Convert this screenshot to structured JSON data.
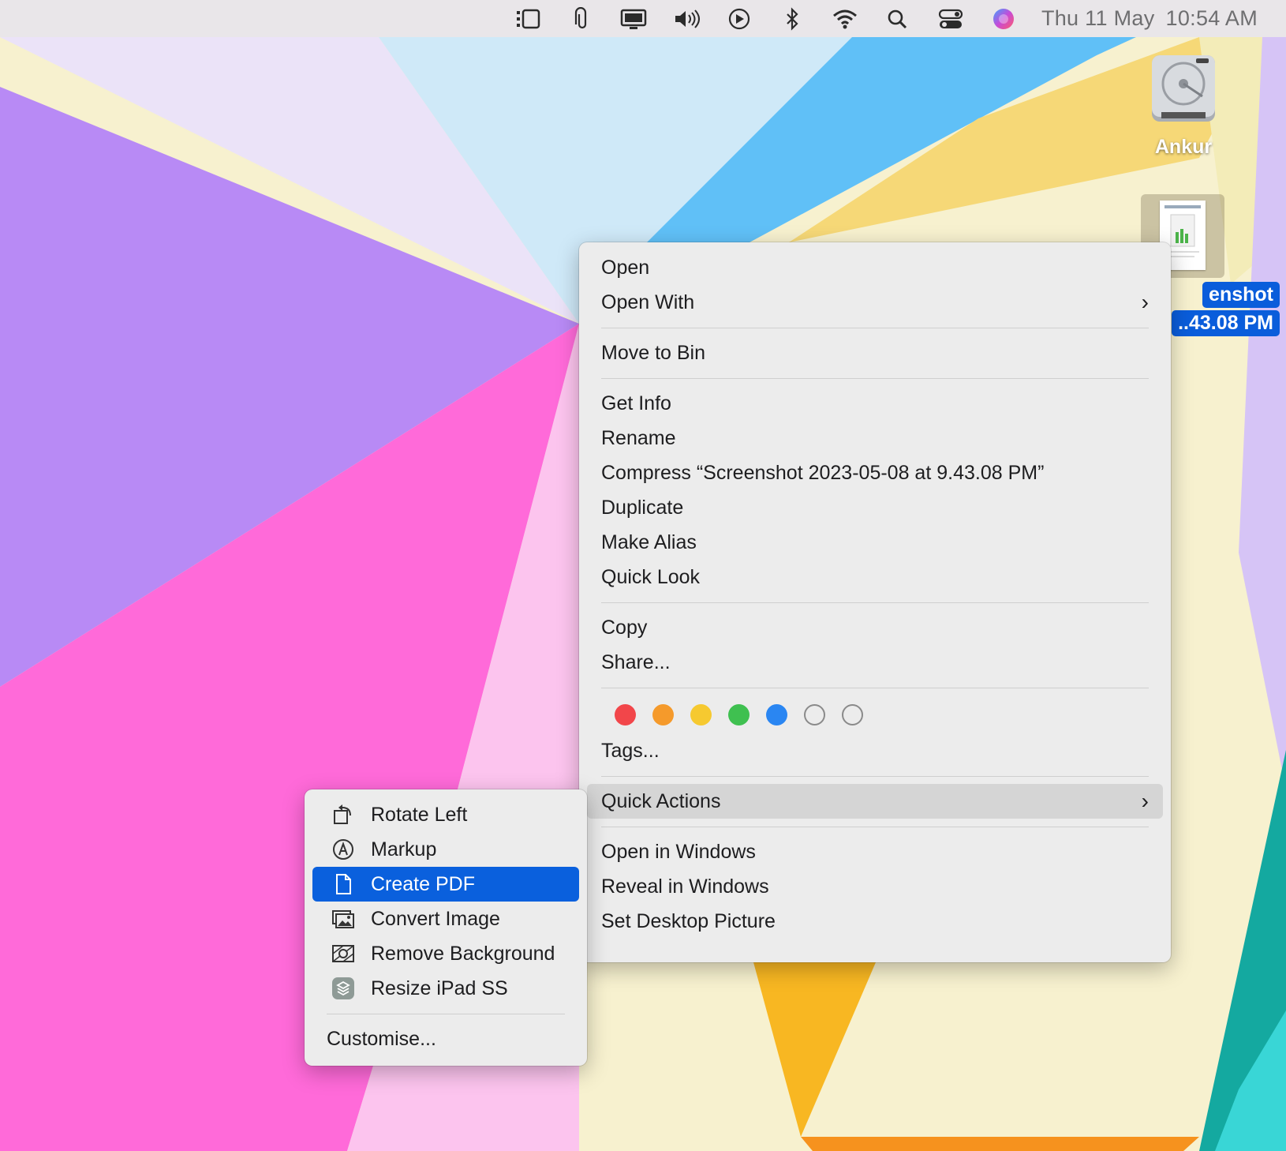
{
  "menubar": {
    "icons": [
      "sidebar-icon",
      "paperclip-icon",
      "display-icon",
      "volume-icon",
      "play-icon",
      "bluetooth-icon",
      "wifi-icon",
      "search-icon",
      "control-center-icon",
      "siri-icon"
    ],
    "date": "Thu 11 May",
    "time": "10:54 AM"
  },
  "desktop": {
    "drive_label": "Ankur",
    "file_label_line1": "enshot",
    "file_label_line2": "..43.08 PM"
  },
  "context_menu": {
    "open": "Open",
    "open_with": "Open With",
    "move_to_bin": "Move to Bin",
    "get_info": "Get Info",
    "rename": "Rename",
    "compress": "Compress “Screenshot 2023-05-08 at 9.43.08 PM”",
    "duplicate": "Duplicate",
    "make_alias": "Make Alias",
    "quick_look": "Quick Look",
    "copy": "Copy",
    "share": "Share...",
    "tag_colors": [
      "#f2464a",
      "#f59a2b",
      "#f6c930",
      "#3fc050",
      "#2a86f2",
      "none",
      "none"
    ],
    "tags": "Tags...",
    "quick_actions": "Quick Actions",
    "open_in_windows": "Open in Windows",
    "reveal_in_windows": "Reveal in Windows",
    "set_desktop_picture": "Set Desktop Picture"
  },
  "quick_actions_menu": {
    "rotate_left": "Rotate Left",
    "markup": "Markup",
    "create_pdf": "Create PDF",
    "convert_image": "Convert Image",
    "remove_background": "Remove Background",
    "resize_ipad": "Resize iPad SS",
    "customise": "Customise..."
  },
  "colors": {
    "selection": "#0a60dd",
    "menu_bg": "#ececec",
    "menubar_bg": "#e9e6e9"
  }
}
